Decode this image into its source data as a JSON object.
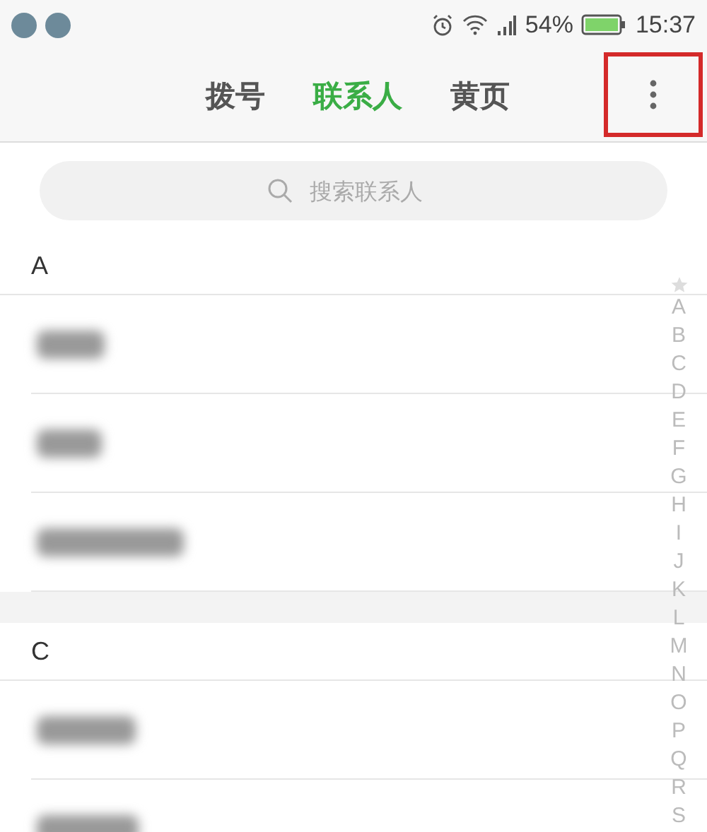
{
  "status_bar": {
    "battery": "54%",
    "time": "15:37"
  },
  "tabs": [
    {
      "label": "拨号",
      "selected": false
    },
    {
      "label": "联系人",
      "selected": true
    },
    {
      "label": "黄页",
      "selected": false
    }
  ],
  "menu_highlighted": true,
  "search": {
    "placeholder": "搜索联系人"
  },
  "sections": [
    {
      "letter": "A",
      "contacts": [
        {
          "kind": "blurred"
        },
        {
          "kind": "blurred"
        },
        {
          "kind": "blurred"
        }
      ]
    },
    {
      "letter": "C",
      "contacts": [
        {
          "kind": "blurred"
        },
        {
          "kind": "blurred"
        }
      ]
    }
  ],
  "index": [
    "A",
    "B",
    "C",
    "D",
    "E",
    "F",
    "G",
    "H",
    "I",
    "J",
    "K",
    "L",
    "M",
    "N",
    "O",
    "P",
    "Q",
    "R",
    "S"
  ]
}
